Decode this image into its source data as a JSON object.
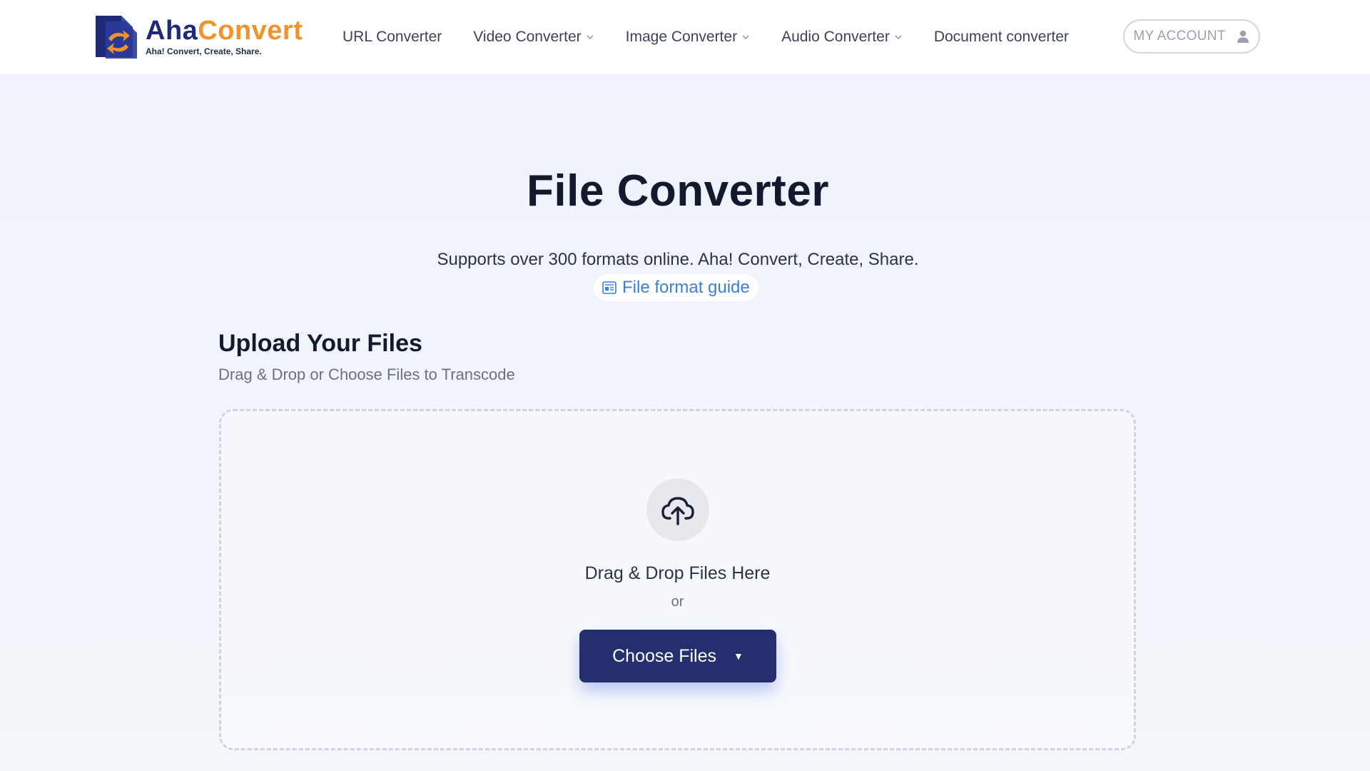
{
  "header": {
    "logo": {
      "name_part1": "Aha",
      "name_part2": "Convert",
      "tagline": "Aha! Convert, Create, Share.",
      "colors": {
        "primary": "#1e2a78",
        "accent": "#f0932b"
      }
    },
    "nav": [
      {
        "label": "URL Converter",
        "has_dropdown": false
      },
      {
        "label": "Video Converter",
        "has_dropdown": true
      },
      {
        "label": "Image Converter",
        "has_dropdown": true
      },
      {
        "label": "Audio Converter",
        "has_dropdown": true
      },
      {
        "label": "Document converter",
        "has_dropdown": false
      }
    ],
    "account": {
      "label": "MY ACCOUNT",
      "icon": "user-icon"
    }
  },
  "main": {
    "title": "File Converter",
    "subtitle": "Supports over 300 formats online. Aha! Convert, Create, Share.",
    "guide_link": {
      "label": "File format guide",
      "icon": "document-list-icon",
      "color": "#3b7fd6"
    },
    "upload": {
      "heading": "Upload Your Files",
      "subheading": "Drag & Drop or Choose Files to Transcode",
      "dropzone": {
        "icon": "cloud-upload-icon",
        "text": "Drag & Drop Files Here",
        "or": "or",
        "button": {
          "label": "Choose Files",
          "caret": "▼",
          "color": "#252f6e"
        }
      }
    }
  }
}
